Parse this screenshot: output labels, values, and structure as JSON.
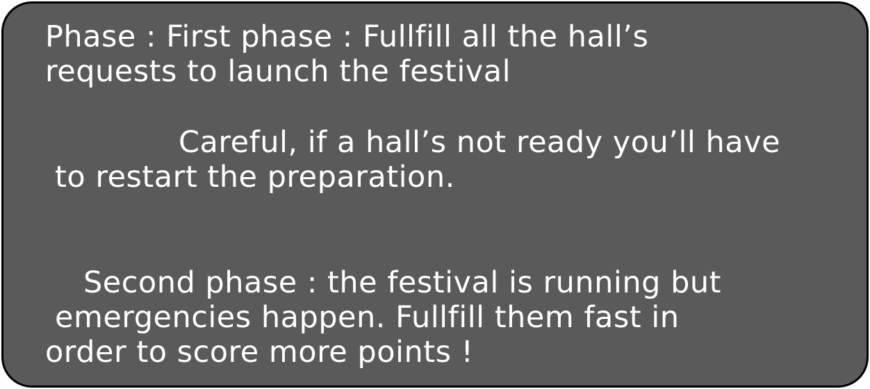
{
  "dialog": {
    "phase_one": {
      "line1": "Phase : First phase : Fullfill all the hall’s",
      "line2": "requests to launch the festival"
    },
    "warning": {
      "line1": "Careful, if a hall’s not ready you’ll have",
      "line2": "to restart the preparation."
    },
    "phase_two": {
      "line1": "Second phase : the festival is running but",
      "line2": "emergencies happen. Fullfill them fast in",
      "line3": "order to score more points !"
    }
  },
  "colors": {
    "panel_background": "#5a5a5a",
    "panel_border": "#000000",
    "text": "#ffffff"
  }
}
